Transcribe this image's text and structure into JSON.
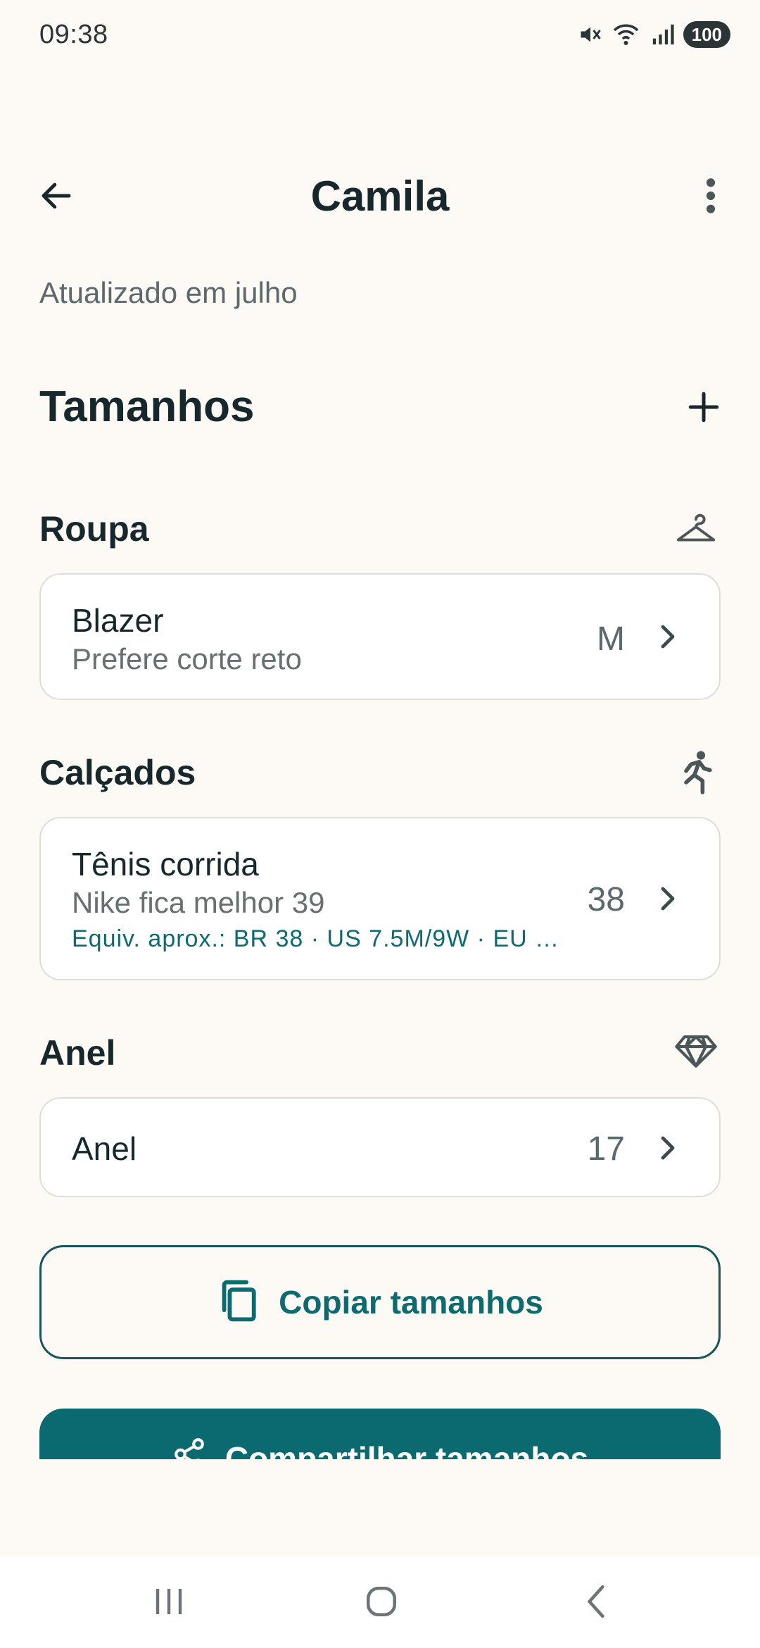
{
  "status_bar": {
    "time": "09:38",
    "battery": "100",
    "icons": [
      "mute-icon",
      "wifi-icon",
      "signal-icon",
      "battery-icon"
    ]
  },
  "header": {
    "title": "Camila",
    "back_icon": "arrow-left-icon",
    "more_icon": "more-vertical-icon"
  },
  "updated_text": "Atualizado em julho",
  "sizes_section": {
    "title": "Tamanhos",
    "add_icon": "plus-icon"
  },
  "categories": [
    {
      "label": "Roupa",
      "icon": "hanger-icon",
      "items": [
        {
          "title": "Blazer",
          "subtitle": "Prefere corte reto",
          "value": "M"
        }
      ]
    },
    {
      "label": "Calçados",
      "icon": "running-icon",
      "items": [
        {
          "title": "Tênis corrida",
          "subtitle": "Nike fica melhor 39",
          "equiv": "Equiv. aprox.: BR 38 · US 7.5M/9W · EU …",
          "value": "38"
        }
      ]
    },
    {
      "label": "Anel",
      "icon": "diamond-icon",
      "items": [
        {
          "title": "Anel",
          "value": "17"
        }
      ]
    }
  ],
  "actions": {
    "copy_label": "Copiar tamanhos",
    "copy_icon": "copy-icon",
    "share_label": "Compartilhar tamanhos",
    "share_icon": "share-icon"
  },
  "colors": {
    "accent": "#0a6a70",
    "background": "#fdfaf6",
    "text": "#17282d"
  }
}
